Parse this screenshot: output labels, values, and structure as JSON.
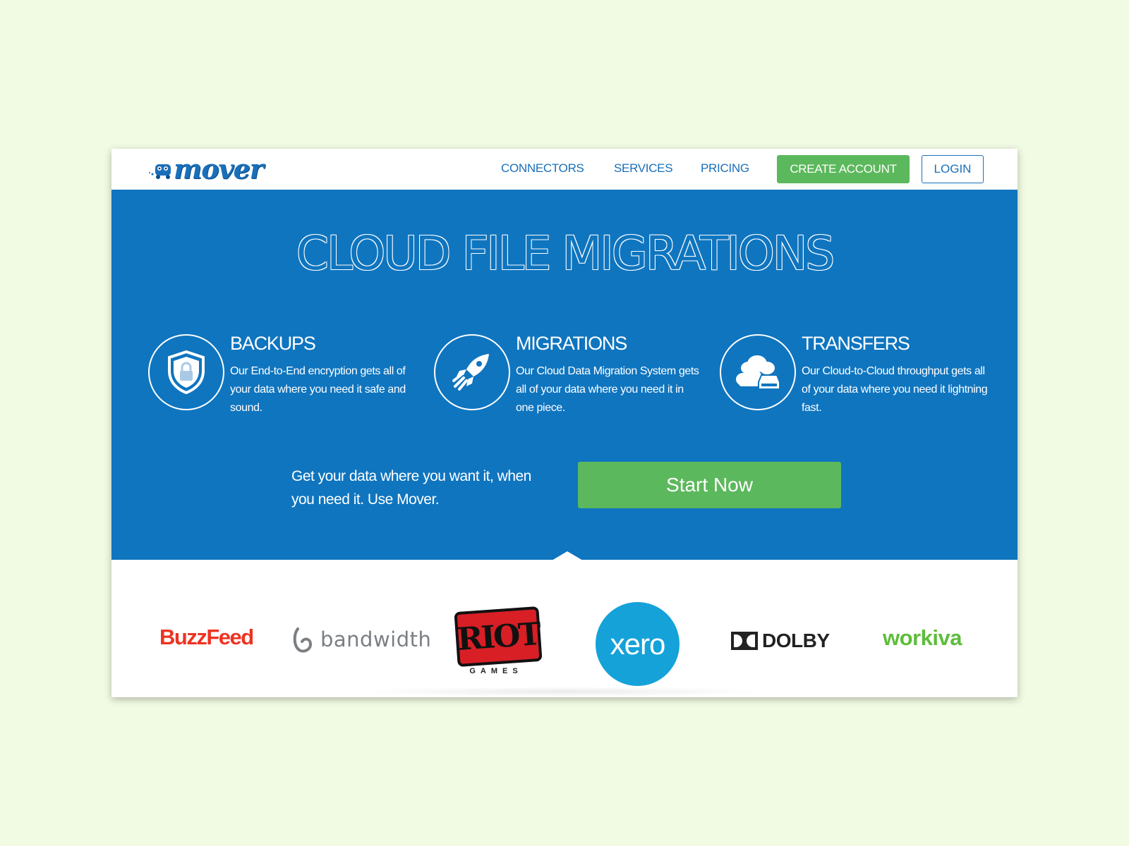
{
  "nav": {
    "logo": "mover",
    "links": [
      "CONNECTORS",
      "SERVICES",
      "PRICING"
    ],
    "create_account": "CREATE ACCOUNT",
    "login": "LOGIN"
  },
  "hero": {
    "title": "CLOUD FILE MIGRATIONS",
    "features": [
      {
        "icon": "shield-lock-icon",
        "title": "BACKUPS",
        "desc": "Our End-to-End encryption gets all of your data where you need it safe and sound."
      },
      {
        "icon": "rocket-icon",
        "title": "MIGRATIONS",
        "desc": "Our Cloud Data Migration System gets all of your data where you need it in one piece."
      },
      {
        "icon": "cloud-drive-icon",
        "title": "TRANSFERS",
        "desc": "Our Cloud-to-Cloud throughput gets all of your data where you need it lightning fast."
      }
    ],
    "tagline": "Get your data where you want it, when you need it. Use Mover.",
    "cta": "Start Now"
  },
  "customers": {
    "buzzfeed": "BuzzFeed",
    "bandwidth": "bandwidth",
    "riot": "RIOT",
    "riot_sub": "GAMES",
    "xero": "xero",
    "dolby": "DOLBY",
    "workiva": "workiva"
  },
  "colors": {
    "background": "#f1fbe3",
    "brand_blue": "#0f75bf",
    "link_blue": "#1a6fb9",
    "cta_green": "#5cb85c"
  }
}
